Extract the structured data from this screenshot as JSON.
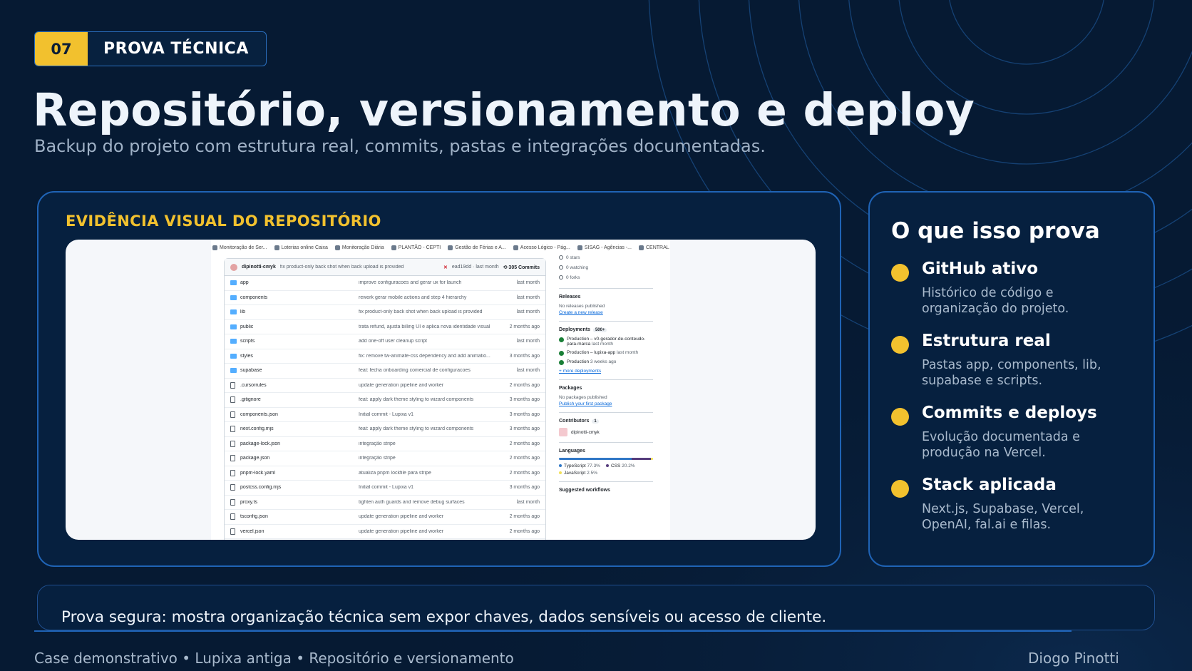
{
  "badge": {
    "number": "07",
    "label": "PROVA TÉCNICA"
  },
  "title": "Repositório, versionamento e deploy",
  "subtitle": "Backup do projeto com estrutura real, commits, pastas e integrações documentadas.",
  "colors": {
    "background": "#061a33",
    "accent": "#f2c12e",
    "border": "#1f63b5"
  },
  "evidence": {
    "title": "EVIDÊNCIA VISUAL DO REPOSITÓRIO",
    "screenshot": {
      "bookmarks": [
        "Monitoração de Ser...",
        "Loterias online Caixa",
        "Monitoração Diária",
        "PLANTÃO - CEPTI",
        "Gestão de Férias e A...",
        "Acesso Lógico - Pág...",
        "SISAG - Agências -...",
        "CENTRAL DE ACIO"
      ],
      "commit": {
        "user": "dipinotti-cmyk",
        "message": "fix product-only back shot when back upload is provided",
        "hash": "ead19dd · last month",
        "count": "305 Commits"
      },
      "files": [
        {
          "type": "dir",
          "name": "app",
          "message": "improve configuracoes and gerar ux for launch",
          "time": "last month"
        },
        {
          "type": "dir",
          "name": "components",
          "message": "rework gerar mobile actions and step 4 hierarchy",
          "time": "last month"
        },
        {
          "type": "dir",
          "name": "lib",
          "message": "fix product-only back shot when back upload is provided",
          "time": "last month"
        },
        {
          "type": "dir",
          "name": "public",
          "message": "trata refund, ajusta billing UI e aplica nova identidade visual",
          "time": "2 months ago"
        },
        {
          "type": "dir",
          "name": "scripts",
          "message": "add one-off user cleanup script",
          "time": "last month"
        },
        {
          "type": "dir",
          "name": "styles",
          "message": "fix: remove tw-animate-css dependency and add animatio...",
          "time": "3 months ago"
        },
        {
          "type": "dir",
          "name": "supabase",
          "message": "feat: fecha onboarding comercial de configuracoes",
          "time": "last month"
        },
        {
          "type": "file",
          "name": ".cursorrules",
          "message": "update generation pipeline and worker",
          "time": "2 months ago"
        },
        {
          "type": "file",
          "name": ".gitignore",
          "message": "feat: apply dark theme styling to wizard components",
          "time": "3 months ago"
        },
        {
          "type": "file",
          "name": "components.json",
          "message": "Initial commit - Lupixa v1",
          "time": "3 months ago"
        },
        {
          "type": "file",
          "name": "next.config.mjs",
          "message": "feat: apply dark theme styling to wizard components",
          "time": "3 months ago"
        },
        {
          "type": "file",
          "name": "package-lock.json",
          "message": "integração stripe",
          "time": "2 months ago"
        },
        {
          "type": "file",
          "name": "package.json",
          "message": "integração stripe",
          "time": "2 months ago"
        },
        {
          "type": "file",
          "name": "pnpm-lock.yaml",
          "message": "atualiza pnpm lockfile para stripe",
          "time": "2 months ago"
        },
        {
          "type": "file",
          "name": "postcss.config.mjs",
          "message": "Initial commit - Lupixa v1",
          "time": "3 months ago"
        },
        {
          "type": "file",
          "name": "proxy.ts",
          "message": "tighten auth guards and remove debug surfaces",
          "time": "last month"
        },
        {
          "type": "file",
          "name": "tsconfig.json",
          "message": "update generation pipeline and worker",
          "time": "2 months ago"
        },
        {
          "type": "file",
          "name": "vercel.json",
          "message": "update generation pipeline and worker",
          "time": "2 months ago"
        }
      ],
      "sidebar": {
        "stars": "0 stars",
        "watching": "0 watching",
        "forks": "0 forks",
        "releases_title": "Releases",
        "releases_empty": "No releases published",
        "releases_link": "Create a new release",
        "deployments_title": "Deployments",
        "deployments_count": "500+",
        "deployments": [
          {
            "name": "Production – v0-gerador-de-conteudo-para-marca",
            "time": "last month"
          },
          {
            "name": "Production – lupixa-app",
            "time": "last month"
          },
          {
            "name": "Production",
            "time": "3 weeks ago"
          }
        ],
        "deployments_more": "+ more deployments",
        "packages_title": "Packages",
        "packages_empty": "No packages published",
        "packages_link": "Publish your first package",
        "contributors_title": "Contributors",
        "contributors_count": "1",
        "contributor": "dipinotti-cmyk",
        "languages_title": "Languages",
        "languages": [
          {
            "name": "TypeScript",
            "percent": "77.3%",
            "value": 77.3,
            "color": "#3178c6"
          },
          {
            "name": "CSS",
            "percent": "20.2%",
            "value": 20.2,
            "color": "#563d7c"
          },
          {
            "name": "JavaScript",
            "percent": "2.5%",
            "value": 2.5,
            "color": "#f1e05a"
          }
        ],
        "workflows_title": "Suggested workflows"
      }
    }
  },
  "proves": {
    "title": "O que isso prova",
    "items": [
      {
        "heading": "GitHub ativo",
        "desc_line1": "Histórico de código e",
        "desc_line2": "organização do projeto."
      },
      {
        "heading": "Estrutura real",
        "desc_line1": "Pastas app, components, lib,",
        "desc_line2": "supabase e scripts."
      },
      {
        "heading": "Commits e deploys",
        "desc_line1": "Evolução documentada e",
        "desc_line2": "produção na Vercel."
      },
      {
        "heading": "Stack aplicada",
        "desc_line1": "Next.js, Supabase, Vercel,",
        "desc_line2": "OpenAI, fal.ai e filas."
      }
    ]
  },
  "safe_note": "Prova segura: mostra organização técnica sem expor chaves, dados sensíveis ou acesso de cliente.",
  "footer": {
    "left": "Case demonstrativo • Lupixa antiga • Repositório e versionamento",
    "right": "Diogo Pinotti"
  }
}
